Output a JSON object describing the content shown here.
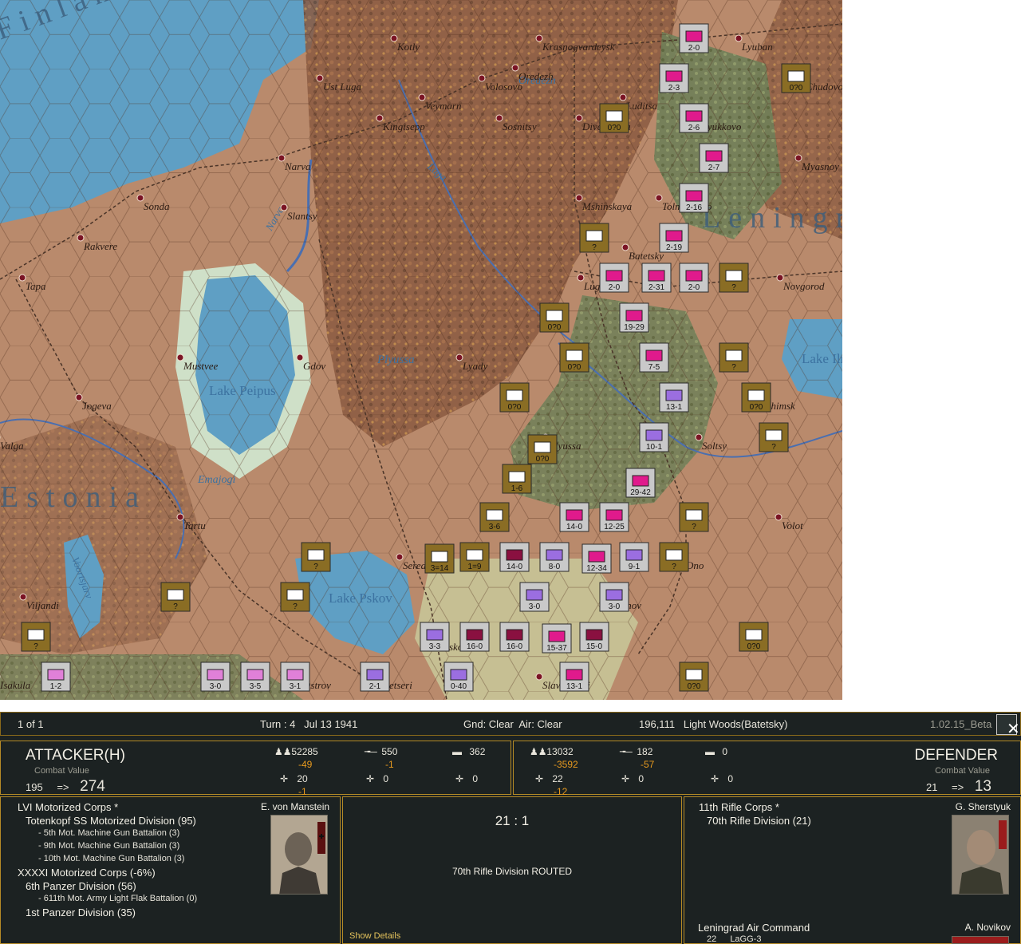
{
  "map": {
    "places": [
      {
        "name": "Kotly"
      },
      {
        "name": "Krasnogvardeysk"
      },
      {
        "name": "Lyuban"
      },
      {
        "name": "Ust Luga"
      },
      {
        "name": "Volosovo"
      },
      {
        "name": "Oredezh"
      },
      {
        "name": "Chudovo"
      },
      {
        "name": "Veymarn"
      },
      {
        "name": "Kingisepp"
      },
      {
        "name": "Sosnitsy"
      },
      {
        "name": "Luditsa"
      },
      {
        "name": "Diveňskaya"
      },
      {
        "name": "Lyukkovo"
      },
      {
        "name": "Narva"
      },
      {
        "name": "Myasnoy"
      },
      {
        "name": "Sonda"
      },
      {
        "name": "Slantsy"
      },
      {
        "name": "Mshinskaya"
      },
      {
        "name": "Tolmachevo"
      },
      {
        "name": "Rakvere"
      },
      {
        "name": "Batetsky"
      },
      {
        "name": "Tapa"
      },
      {
        "name": "Luga"
      },
      {
        "name": "Novgorod"
      },
      {
        "name": "Mustvee"
      },
      {
        "name": "Gdov"
      },
      {
        "name": "Lyady"
      },
      {
        "name": "Jogeva"
      },
      {
        "name": "Shimsk"
      },
      {
        "name": "Plyussa"
      },
      {
        "name": "Soltsy"
      },
      {
        "name": "Tartu"
      },
      {
        "name": "Volot"
      },
      {
        "name": "Seredka"
      },
      {
        "name": "Dno"
      },
      {
        "name": "Viljandi"
      },
      {
        "name": "Porkhov"
      },
      {
        "name": "Pskov"
      },
      {
        "name": "Valga"
      },
      {
        "name": "Isakula"
      },
      {
        "name": "Ostrov"
      },
      {
        "name": "Petseri"
      },
      {
        "name": "Slavkovichi"
      }
    ],
    "water_labels": [
      "Lake Peipus",
      "Lake Pskov",
      "Lake Ilmen",
      "Plyussa",
      "Emajogi",
      "Voortsjarv",
      "Narva",
      "Luga",
      "Oredezh"
    ],
    "region_labels": [
      "Finland",
      "Leningrad",
      "Estonia"
    ],
    "counters": [
      {
        "label": "2-0",
        "color": "#e01a8c"
      },
      {
        "label": "2-3",
        "color": "#e01a8c"
      },
      {
        "label": "0?0",
        "color": "#ffffff"
      },
      {
        "label": "0?0",
        "color": "#ffffff"
      },
      {
        "label": "2-6",
        "color": "#e01a8c"
      },
      {
        "label": "2-7",
        "color": "#e01a8c"
      },
      {
        "label": "2-16",
        "color": "#e01a8c"
      },
      {
        "label": "2-19",
        "color": "#e01a8c"
      },
      {
        "label": "?",
        "color": "#ffffff"
      },
      {
        "label": "2-0",
        "color": "#e01a8c"
      },
      {
        "label": "2-31",
        "color": "#e01a8c"
      },
      {
        "label": "2-0",
        "color": "#e01a8c"
      },
      {
        "label": "?",
        "color": "#ffffff"
      },
      {
        "label": "0?0",
        "color": "#ffffff"
      },
      {
        "label": "19-29",
        "color": "#e01a8c"
      },
      {
        "label": "0?0",
        "color": "#ffffff"
      },
      {
        "label": "7-5",
        "color": "#e01a8c"
      },
      {
        "label": "?",
        "color": "#ffffff"
      },
      {
        "label": "0?0",
        "color": "#ffffff"
      },
      {
        "label": "13-1",
        "color": "#9b6ee0"
      },
      {
        "label": "0?0",
        "color": "#ffffff"
      },
      {
        "label": "10-1",
        "color": "#9b6ee0"
      },
      {
        "label": "?",
        "color": "#ffffff"
      },
      {
        "label": "0?0",
        "color": "#ffffff"
      },
      {
        "label": "1-6",
        "color": "#ffffff"
      },
      {
        "label": "29-42",
        "color": "#e01a8c"
      },
      {
        "label": "3-6",
        "color": "#ffffff"
      },
      {
        "label": "14-0",
        "color": "#e01a8c"
      },
      {
        "label": "12-25",
        "color": "#e01a8c"
      },
      {
        "label": "?",
        "color": "#ffffff"
      },
      {
        "label": "?",
        "color": "#ffffff"
      },
      {
        "label": "3=14",
        "color": "#ffffff"
      },
      {
        "label": "1=9",
        "color": "#ffffff"
      },
      {
        "label": "14-0",
        "color": "#8a1040"
      },
      {
        "label": "8-0",
        "color": "#9b6ee0"
      },
      {
        "label": "12-34",
        "color": "#e01a8c"
      },
      {
        "label": "9-1",
        "color": "#9b6ee0"
      },
      {
        "label": "?",
        "color": "#ffffff"
      },
      {
        "label": "?",
        "color": "#ffffff"
      },
      {
        "label": "?",
        "color": "#ffffff"
      },
      {
        "label": "3-0",
        "color": "#9b6ee0"
      },
      {
        "label": "3-0",
        "color": "#9b6ee0"
      },
      {
        "label": "?",
        "color": "#ffffff"
      },
      {
        "label": "3-3",
        "color": "#9b6ee0"
      },
      {
        "label": "16-0",
        "color": "#8a1040"
      },
      {
        "label": "16-0",
        "color": "#8a1040"
      },
      {
        "label": "15-37",
        "color": "#e01a8c"
      },
      {
        "label": "15-0",
        "color": "#8a1040"
      },
      {
        "label": "0?0",
        "color": "#ffffff"
      },
      {
        "label": "1-2",
        "color": "#e080d8"
      },
      {
        "label": "3-0",
        "color": "#e080d8"
      },
      {
        "label": "3-5",
        "color": "#e080d8"
      },
      {
        "label": "3-1",
        "color": "#e080d8"
      },
      {
        "label": "2-1",
        "color": "#9b6ee0"
      },
      {
        "label": "0-40",
        "color": "#9b6ee0"
      },
      {
        "label": "13-1",
        "color": "#e01a8c"
      },
      {
        "label": "0?0",
        "color": "#ffffff"
      }
    ]
  },
  "status": {
    "page": "1 of 1",
    "turn": "Turn : 4   Jul 13 1941",
    "weather": "Gnd: Clear  Air: Clear",
    "hex": "196,111   Light Woods(Batetsky)",
    "version": "1.02.15_Beta",
    "close_icon": "close-icon"
  },
  "attacker": {
    "title": "ATTACKER(H)",
    "cv_label": "Combat Value",
    "cv_old": "195",
    "cv_arrow": "=>",
    "cv_new": "274",
    "men": "52285",
    "men_delta": "-49",
    "guns": "550",
    "guns_delta": "-1",
    "tanks": "362",
    "aircraft": "20",
    "aircraft_delta": "-1",
    "bombers": "0",
    "fighters": "0",
    "formations": [
      {
        "text": "LVI Motorized Corps *",
        "level": 0
      },
      {
        "text": "Totenkopf SS Motorized Division (95)",
        "level": 1
      },
      {
        "text": "- 5th Mot. Machine Gun Battalion (3)",
        "level": 2
      },
      {
        "text": "- 9th Mot. Machine Gun Battalion (3)",
        "level": 2
      },
      {
        "text": "- 10th Mot. Machine Gun Battalion (3)",
        "level": 2
      },
      {
        "text": "XXXXI Motorized Corps (-6%)",
        "level": 0
      },
      {
        "text": "6th Panzer Division (56)",
        "level": 1
      },
      {
        "text": "- 611th Mot. Army Light Flak Battalion (0)",
        "level": 2
      },
      {
        "text": "1st Panzer Division (35)",
        "level": 1
      }
    ],
    "commander": "E. von Manstein"
  },
  "defender": {
    "title": "DEFENDER",
    "cv_label": "Combat Value",
    "cv_old": "21",
    "cv_arrow": "=>",
    "cv_new": "13",
    "men": "13032",
    "men_delta": "-3592",
    "guns": "182",
    "guns_delta": "-57",
    "tanks": "0",
    "aircraft": "22",
    "aircraft_delta": "-12",
    "bombers": "0",
    "fighters": "0",
    "formations": [
      {
        "text": "11th Rifle Corps *",
        "level": 0
      },
      {
        "text": "70th Rifle Division (21)",
        "level": 1
      }
    ],
    "commander": "G. Sherstyuk",
    "air_command": "Leningrad Air Command",
    "air_commander": "A. Novikov",
    "air_count": "22",
    "air_type": "LaGG-3"
  },
  "result": {
    "odds": "21 : 1",
    "message": "70th Rifle Division ROUTED",
    "details_link": "Show Details"
  }
}
